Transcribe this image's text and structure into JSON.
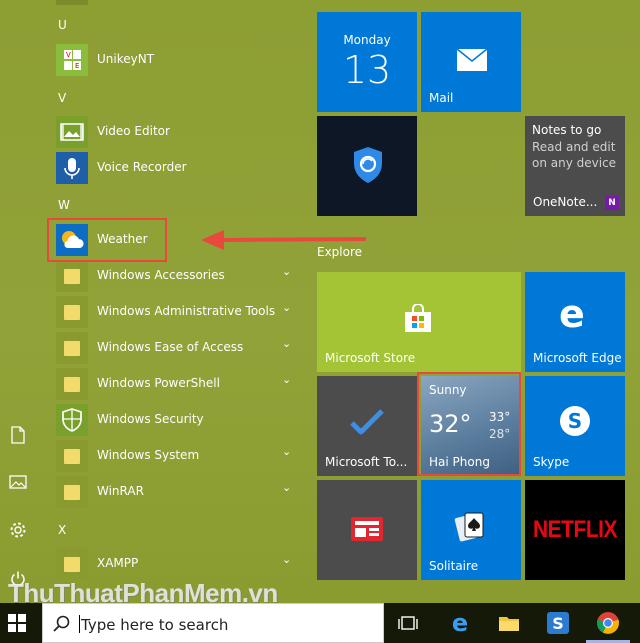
{
  "letters": {
    "u": "U",
    "v": "V",
    "w": "W",
    "x": "X"
  },
  "apps": {
    "unikey": "UnikeyNT",
    "video_editor": "Video Editor",
    "voice_recorder": "Voice Recorder",
    "weather": "Weather",
    "win_accessories": "Windows Accessories",
    "win_admin_tools": "Windows Administrative Tools",
    "win_ease": "Windows Ease of Access",
    "win_powershell": "Windows PowerShell",
    "win_security": "Windows Security",
    "win_system": "Windows System",
    "winrar": "WinRAR",
    "xampp": "XAMPP"
  },
  "tiles": {
    "calendar_day": "Monday",
    "calendar_date": "13",
    "mail": "Mail",
    "notes_title": "Notes to go",
    "notes_body": "Read and edit on any device",
    "onenote": "OneNote...",
    "explore": "Explore",
    "store": "Microsoft Store",
    "edge": "Microsoft Edge",
    "todo": "Microsoft To...",
    "weather_cond": "Sunny",
    "weather_temp": "32°",
    "weather_high": "33°",
    "weather_low": "28°",
    "weather_city": "Hai Phong",
    "skype": "Skype",
    "solitaire": "Solitaire",
    "netflix": "NETFLIX"
  },
  "search": {
    "placeholder": "Type here to search"
  },
  "watermark": "ThuThuatPhanMem.vn",
  "colors": {
    "tile_blue": "#0078d7",
    "tile_green": "#a3c434",
    "highlight": "#e8493e",
    "netflix_red": "#e50914"
  }
}
